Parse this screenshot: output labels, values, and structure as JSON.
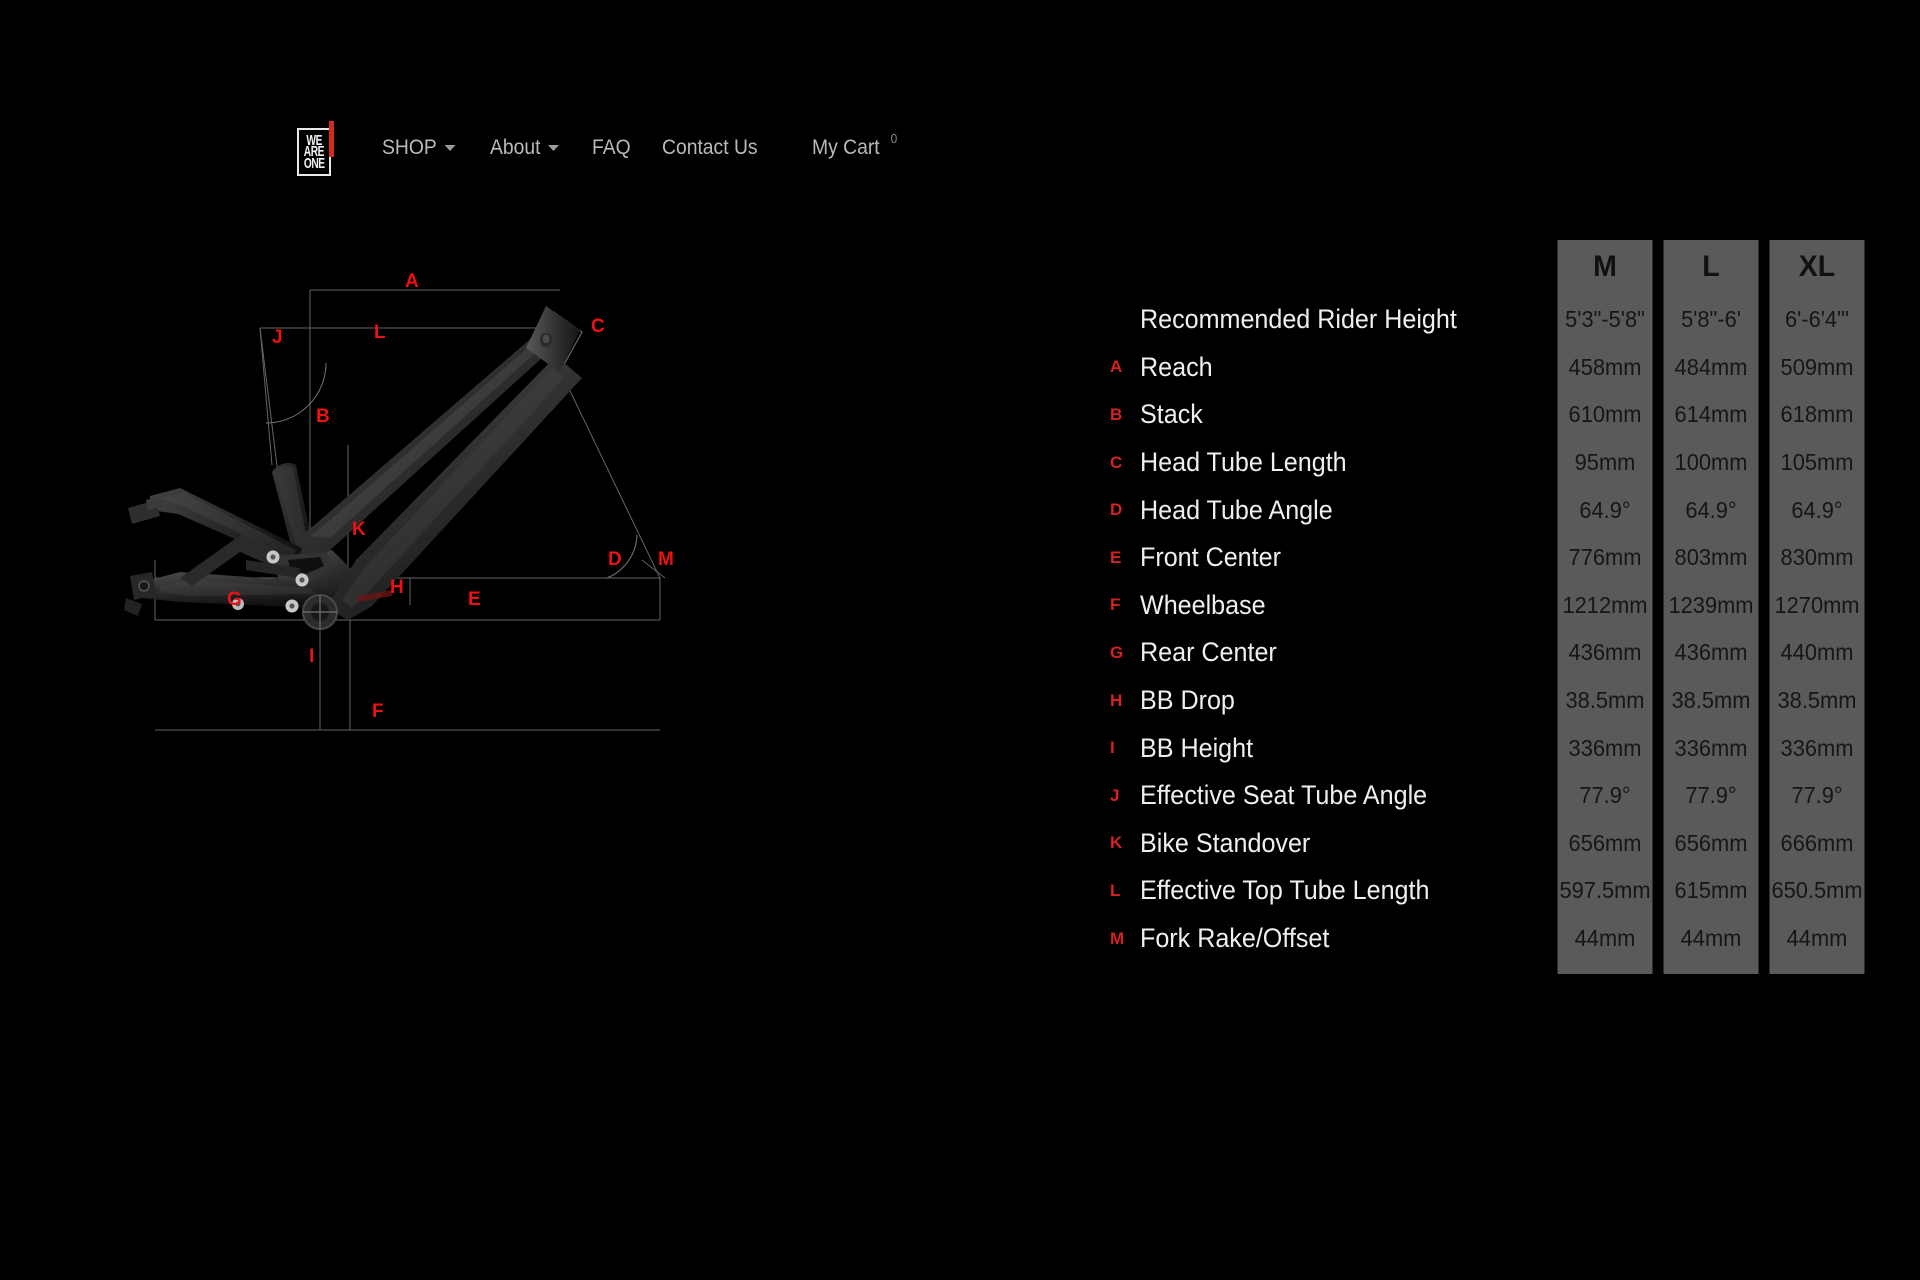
{
  "header": {
    "logo": {
      "lines": [
        "WE",
        "ARE",
        "ONE"
      ],
      "accent_color": "#d52b1e"
    },
    "nav": [
      {
        "label": "SHOP",
        "has_caret": true
      },
      {
        "label": "About",
        "has_caret": true
      },
      {
        "label": "FAQ",
        "has_caret": false
      },
      {
        "label": "Contact Us",
        "has_caret": false
      }
    ],
    "cart": {
      "label": "My Cart",
      "count": "0"
    }
  },
  "diagram": {
    "labels": [
      {
        "key": "A",
        "text": "A"
      },
      {
        "key": "B",
        "text": "B"
      },
      {
        "key": "C",
        "text": "C"
      },
      {
        "key": "D",
        "text": "D"
      },
      {
        "key": "E",
        "text": "E"
      },
      {
        "key": "F",
        "text": "F"
      },
      {
        "key": "G",
        "text": "G"
      },
      {
        "key": "H",
        "text": "H"
      },
      {
        "key": "I",
        "text": "I"
      },
      {
        "key": "J",
        "text": "J"
      },
      {
        "key": "K",
        "text": "K"
      },
      {
        "key": "L",
        "text": "L"
      },
      {
        "key": "M",
        "text": "M"
      }
    ],
    "colors": {
      "label": "#ee1111",
      "guide": "#7a7a7a",
      "frame_dark": "#1b1b1b",
      "frame_light": "#4a4a4a"
    }
  },
  "table": {
    "columns": [
      "M",
      "L",
      "XL"
    ],
    "rows": [
      {
        "letter": "",
        "label": "Recommended Rider Height",
        "values": [
          "5'3\"-5'8\"",
          "5'8\"-6'",
          "6'-6'4\"'"
        ]
      },
      {
        "letter": "A",
        "label": "Reach",
        "values": [
          "458mm",
          "484mm",
          "509mm"
        ]
      },
      {
        "letter": "B",
        "label": "Stack",
        "values": [
          "610mm",
          "614mm",
          "618mm"
        ]
      },
      {
        "letter": "C",
        "label": "Head Tube Length",
        "values": [
          "95mm",
          "100mm",
          "105mm"
        ]
      },
      {
        "letter": "D",
        "label": "Head Tube Angle",
        "values": [
          "64.9°",
          "64.9°",
          "64.9°"
        ]
      },
      {
        "letter": "E",
        "label": "Front Center",
        "values": [
          "776mm",
          "803mm",
          "830mm"
        ]
      },
      {
        "letter": "F",
        "label": "Wheelbase",
        "values": [
          "1212mm",
          "1239mm",
          "1270mm"
        ]
      },
      {
        "letter": "G",
        "label": "Rear Center",
        "values": [
          "436mm",
          "436mm",
          "440mm"
        ]
      },
      {
        "letter": "H",
        "label": "BB Drop",
        "values": [
          "38.5mm",
          "38.5mm",
          "38.5mm"
        ]
      },
      {
        "letter": "I",
        "label": "BB Height",
        "values": [
          "336mm",
          "336mm",
          "336mm"
        ]
      },
      {
        "letter": "J",
        "label": "Effective Seat Tube Angle",
        "values": [
          "77.9°",
          "77.9°",
          "77.9°"
        ]
      },
      {
        "letter": "K",
        "label": "Bike Standover",
        "values": [
          "656mm",
          "656mm",
          "666mm"
        ]
      },
      {
        "letter": "L",
        "label": "Effective Top Tube Length",
        "values": [
          "597.5mm",
          "615mm",
          "650.5mm"
        ]
      },
      {
        "letter": "M",
        "label": "Fork Rake/Offset",
        "values": [
          "44mm",
          "44mm",
          "44mm"
        ]
      }
    ],
    "colors": {
      "cell_bg": "#5a5a5a",
      "cell_text": "#161616",
      "label_text": "#efefef",
      "letter_text": "#d62222"
    }
  }
}
